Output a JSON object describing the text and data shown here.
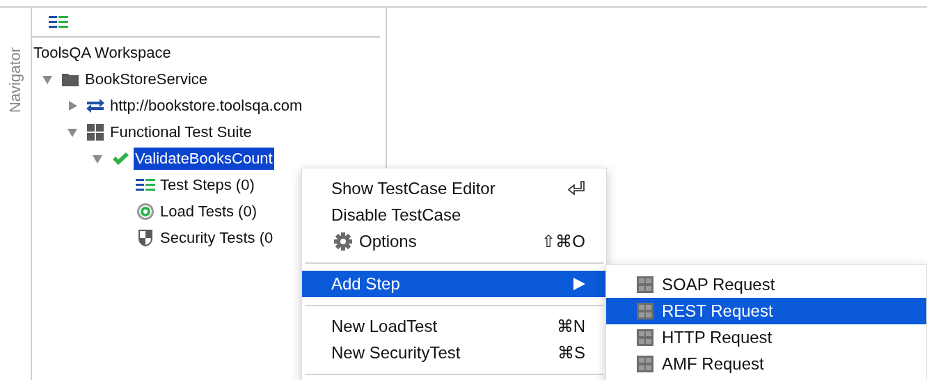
{
  "side_tab": {
    "label": "Navigator"
  },
  "tree": {
    "root": "ToolsQA Workspace",
    "nodes": [
      {
        "label": "BookStoreService",
        "kind": "folder",
        "expanded": true,
        "selected": false,
        "children": [
          {
            "label": "http://bookstore.toolsqa.com",
            "kind": "service",
            "expanded": false,
            "selected": false
          },
          {
            "label": "Functional Test Suite",
            "kind": "suite",
            "expanded": true,
            "selected": false,
            "children": [
              {
                "label": "ValidateBooksCount",
                "kind": "testcase",
                "expanded": true,
                "selected": true,
                "children": [
                  {
                    "label": "Test Steps (0)",
                    "kind": "steps",
                    "selected": false
                  },
                  {
                    "label": "Load Tests (0)",
                    "kind": "load",
                    "selected": false
                  },
                  {
                    "label": "Security Tests (0",
                    "kind": "security",
                    "selected": false
                  }
                ]
              }
            ]
          }
        ]
      }
    ]
  },
  "context_menu": [
    {
      "kind": "return_item",
      "label": "Show TestCase Editor",
      "selected": false
    },
    {
      "kind": "item",
      "label": "Disable TestCase",
      "selected": false
    },
    {
      "kind": "icon_item",
      "label": "Options",
      "shortcut": "⇧⌘O",
      "selected": false
    },
    {
      "kind": "separator"
    },
    {
      "kind": "submenu",
      "label": "Add Step",
      "selected": true
    },
    {
      "kind": "separator"
    },
    {
      "kind": "item",
      "label": "New LoadTest",
      "shortcut": "⌘N",
      "selected": false
    },
    {
      "kind": "item",
      "label": "New SecurityTest",
      "shortcut": "⌘S",
      "selected": false
    },
    {
      "kind": "separator"
    }
  ],
  "submenu": [
    {
      "label": "SOAP Request",
      "selected": false
    },
    {
      "label": "REST Request",
      "selected": true
    },
    {
      "label": "HTTP Request",
      "selected": false
    },
    {
      "label": "AMF Request",
      "selected": false
    }
  ]
}
